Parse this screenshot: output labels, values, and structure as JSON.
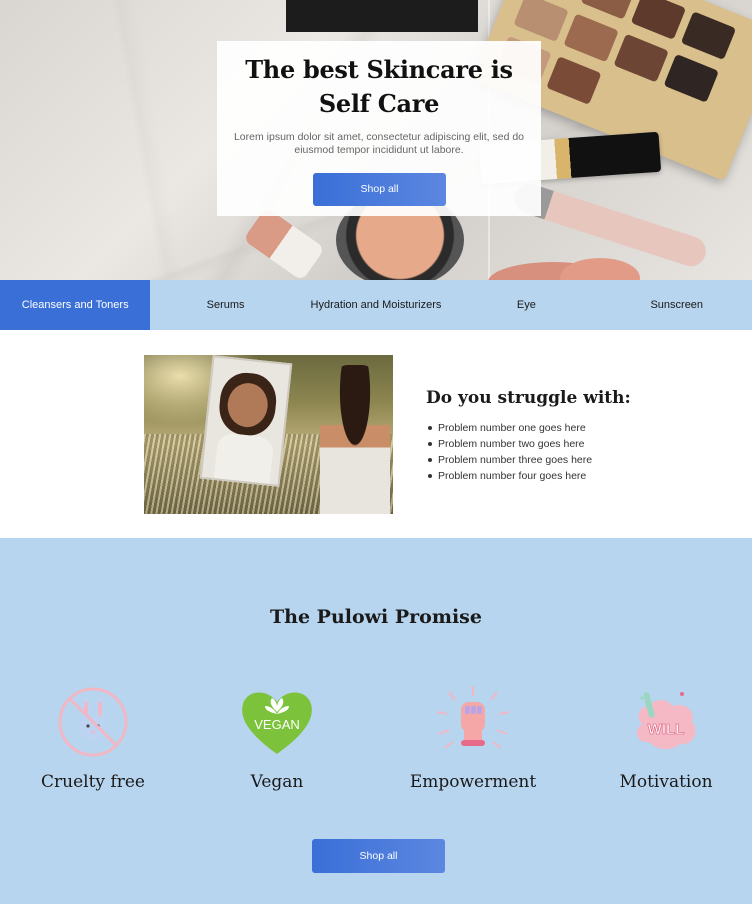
{
  "hero": {
    "title": "The best Skincare is Self Care",
    "subtitle": "Lorem ipsum dolor sit amet, consectetur adipiscing elit, sed do eiusmod tempor incididunt ut labore.",
    "button_label": "Shop all"
  },
  "categories": {
    "tabs": [
      {
        "label": "Cleansers and Toners",
        "active": true
      },
      {
        "label": "Serums",
        "active": false
      },
      {
        "label": "Hydration and Moisturizers",
        "active": false
      },
      {
        "label": "Eye",
        "active": false
      },
      {
        "label": "Sunscreen",
        "active": false
      }
    ]
  },
  "struggle": {
    "title": "Do you struggle with:",
    "problems": [
      "Problem number one goes here",
      "Problem number two goes here",
      "Problem number three goes here",
      "Problem number four goes here"
    ]
  },
  "promise": {
    "title": "The Pulowi Promise",
    "features": [
      {
        "label": "Cruelty free",
        "icon": "no-bunny-icon"
      },
      {
        "label": "Vegan",
        "icon": "vegan-heart-icon",
        "icon_text": "VEGAN"
      },
      {
        "label": "Empowerment",
        "icon": "raised-fist-icon"
      },
      {
        "label": "Motivation",
        "icon": "will-sticker-icon",
        "icon_text": "WILL"
      }
    ],
    "button_label": "Shop all"
  },
  "colors": {
    "accent": "#3a6fd8",
    "light_blue": "#b7d5ee"
  }
}
